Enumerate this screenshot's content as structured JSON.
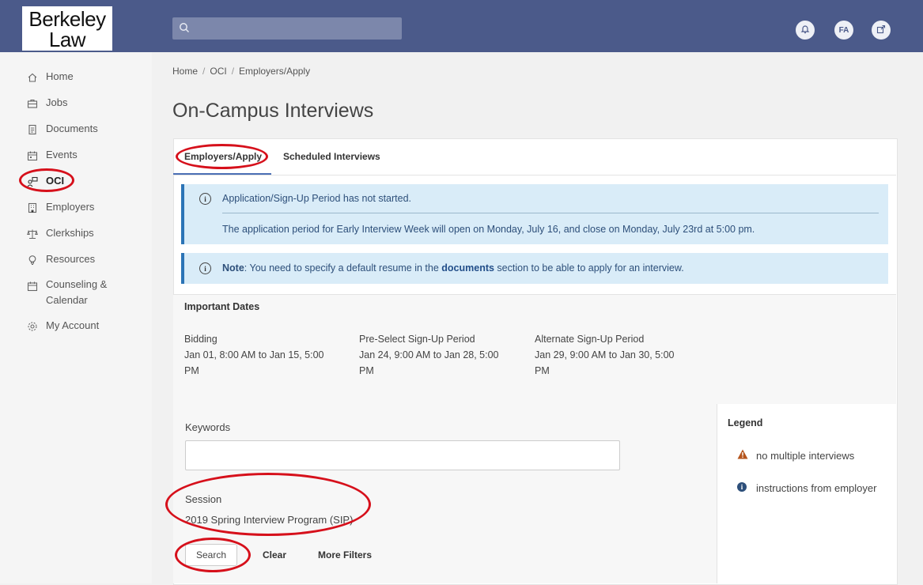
{
  "logo": {
    "line1": "Berkeley",
    "line2": "Law"
  },
  "search": {
    "placeholder": ""
  },
  "topbar": {
    "notifications_icon": "bell-icon",
    "avatar_initials": "FA",
    "external_icon": "external-link-icon"
  },
  "sidebar": {
    "items": [
      {
        "label": "Home",
        "icon": "home-icon"
      },
      {
        "label": "Jobs",
        "icon": "briefcase-icon"
      },
      {
        "label": "Documents",
        "icon": "document-icon"
      },
      {
        "label": "Events",
        "icon": "calendar-icon"
      },
      {
        "label": "OCI",
        "icon": "interview-icon",
        "active": true
      },
      {
        "label": "Employers",
        "icon": "building-icon"
      },
      {
        "label": "Clerkships",
        "icon": "scales-icon"
      },
      {
        "label": "Resources",
        "icon": "lightbulb-icon"
      },
      {
        "label": "Counseling &",
        "label2": "Calendar",
        "icon": "calendar-icon"
      },
      {
        "label": "My Account",
        "icon": "gear-icon"
      }
    ]
  },
  "breadcrumb": {
    "home": "Home",
    "sep": "/",
    "oci": "OCI",
    "current": "Employers/Apply"
  },
  "page_title": "On-Campus Interviews",
  "tabs": [
    {
      "label": "Employers/Apply",
      "active": true
    },
    {
      "label": "Scheduled Interviews",
      "active": false
    }
  ],
  "alerts": {
    "period_title": "Application/Sign-Up Period has not started.",
    "period_detail": "The application period for Early Interview Week will open on Monday, July 16, and close on Monday, July 23rd at 5:00 pm.",
    "note_label": "Note",
    "note_text_1": ": You need to specify a default resume in the ",
    "note_link": "documents",
    "note_text_2": " section to be able to apply for an interview."
  },
  "important_dates": {
    "heading": "Important Dates",
    "columns": [
      {
        "title": "Bidding",
        "line1": "Jan 01, 8:00 AM to Jan 15, 5:00",
        "line2": "PM"
      },
      {
        "title": "Pre-Select Sign-Up Period",
        "line1": "Jan 24, 9:00 AM to Jan 28, 5:00",
        "line2": "PM"
      },
      {
        "title": "Alternate Sign-Up Period",
        "line1": "Jan 29, 9:00 AM to Jan 30, 5:00",
        "line2": "PM"
      }
    ]
  },
  "filters": {
    "keywords_label": "Keywords",
    "keywords_value": "",
    "session_label": "Session",
    "session_value": "2019 Spring Interview Program (SIP)",
    "search_button": "Search",
    "clear_button": "Clear",
    "more_filters_button": "More Filters"
  },
  "legend": {
    "heading": "Legend",
    "items": [
      {
        "icon": "warning-icon",
        "label": "no multiple interviews"
      },
      {
        "icon": "info-icon",
        "label": "instructions from employer"
      }
    ]
  },
  "colors": {
    "topbar": "#4b5a8a",
    "annotation": "#d6101b",
    "alert_bg": "#d9ecf8",
    "alert_border": "#2b74b6",
    "warning": "#b5541c"
  }
}
